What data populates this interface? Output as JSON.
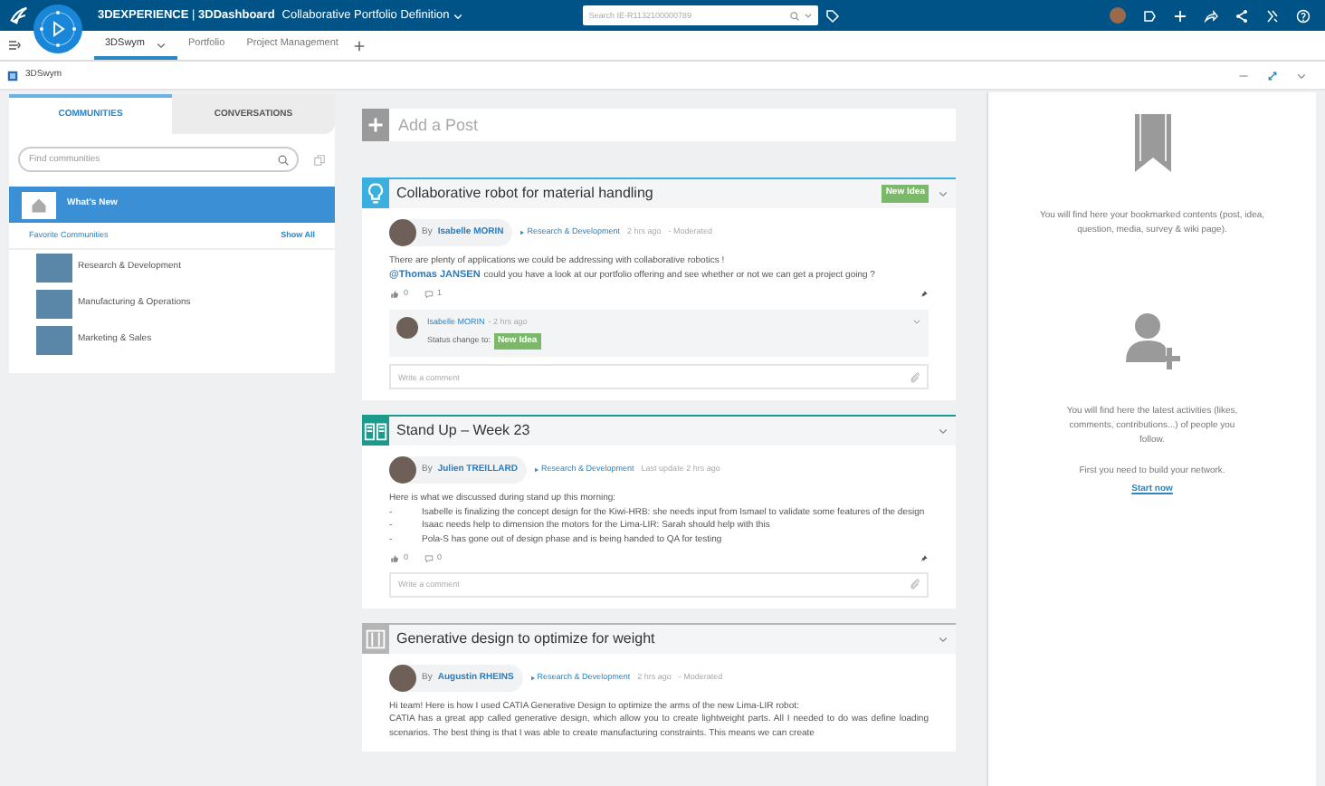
{
  "top_bar": {
    "brand": "3DEXPERIENCE",
    "separator": "|",
    "app": "3DDashboard",
    "dashboard_title": "Collaborative Portfolio Definition",
    "search": {
      "placeholder": "Search IE-R1132100000789"
    }
  },
  "tabs": [
    {
      "label": "3DSwym",
      "selected": true,
      "has_menu": true
    },
    {
      "label": "Portfolio",
      "selected": false,
      "has_menu": false
    },
    {
      "label": "Project Management",
      "selected": false,
      "has_menu": false
    }
  ],
  "widget": {
    "title": "3DSwym"
  },
  "sidebar": {
    "tabs": [
      {
        "label": "COMMUNITIES",
        "selected": true
      },
      {
        "label": "CONVERSATIONS",
        "selected": false
      }
    ],
    "search": {
      "placeholder": "Find communities"
    },
    "whats_new": {
      "label": "What's New",
      "selected": true
    },
    "favorites_heading": "Favorite Communities",
    "show_all": "Show All",
    "communities": [
      {
        "name": "Research & Development"
      },
      {
        "name": "Manufacturing & Operations"
      },
      {
        "name": "Marketing & Sales"
      }
    ]
  },
  "add_post": {
    "placeholder": "Add a Post"
  },
  "posts": [
    {
      "kind": "idea",
      "color": "#3bb0e0",
      "title": "Collaborative robot for material handling",
      "status": "New Idea",
      "by": "By",
      "author": "Isabelle MORIN",
      "community": "Research & Development",
      "time": "2 hrs ago",
      "moderation": "- Moderated",
      "body": [
        {
          "kind": "line",
          "text": "There are plenty of applications we could be addressing with collaborative robotics !"
        },
        {
          "kind": "mention",
          "mention": "@Thomas JANSEN",
          "text": "could you have a look at our portfolio offering and see whether or not we can get a project going ?"
        }
      ],
      "likes": "0",
      "comments": "1",
      "thread": [
        {
          "author": "Isabelle MORIN",
          "time": "- 2 hrs ago",
          "text": "Status change to:",
          "status": "New Idea"
        }
      ],
      "comment_placeholder": "Write a comment"
    },
    {
      "kind": "wiki",
      "color": "#1c9a8c",
      "title": "Stand Up – Week 23",
      "by": "By",
      "author": "Julien TREILLARD",
      "community": "Research & Development",
      "time": "Last update 2 hrs ago",
      "body": [
        {
          "kind": "line",
          "text": "Here is what we discussed during stand up this morning:"
        },
        {
          "kind": "bullet",
          "marker": "-",
          "text": "Isabelle is finalizing the concept design for the Kiwi-HRB: she needs input from Ismael to validate some features of the design"
        },
        {
          "kind": "bullet",
          "marker": "-",
          "text": "Isaac needs help to dimension the motors for the Lima-LIR: Sarah should help with this"
        },
        {
          "kind": "bullet",
          "marker": "-",
          "text": "Pola-S has gone out of design phase and is being handed to QA for testing"
        }
      ],
      "likes": "0",
      "comments": "0",
      "comment_placeholder": "Write a comment"
    },
    {
      "kind": "media",
      "color": "#b5b5b5",
      "title": "Generative design to optimize for weight",
      "by": "By",
      "author": "Augustin RHEINS",
      "community": "Research & Development",
      "time": "2 hrs ago",
      "moderation": "- Moderated",
      "body": [
        {
          "kind": "line",
          "text": "Hi team! Here is how I used CATIA Generative Design to optimize the arms of the new Lima-LIR robot:"
        },
        {
          "kind": "line",
          "text": "CATIA has a great app called generative design, which allow you to create lightweight parts. All I needed to do was define loading scenarios. The best thing is that I was able to create manufacturing constraints. This means we can create"
        }
      ]
    }
  ],
  "bookmarks": {
    "text": "You will find here your bookmarked contents (post, idea, question, media, survey & wiki page)."
  },
  "activity": {
    "text": "You will find here the latest activities (likes, comments, contributions...) of people you follow.",
    "prompt": "First you need to build your network.",
    "link": "Start now"
  }
}
